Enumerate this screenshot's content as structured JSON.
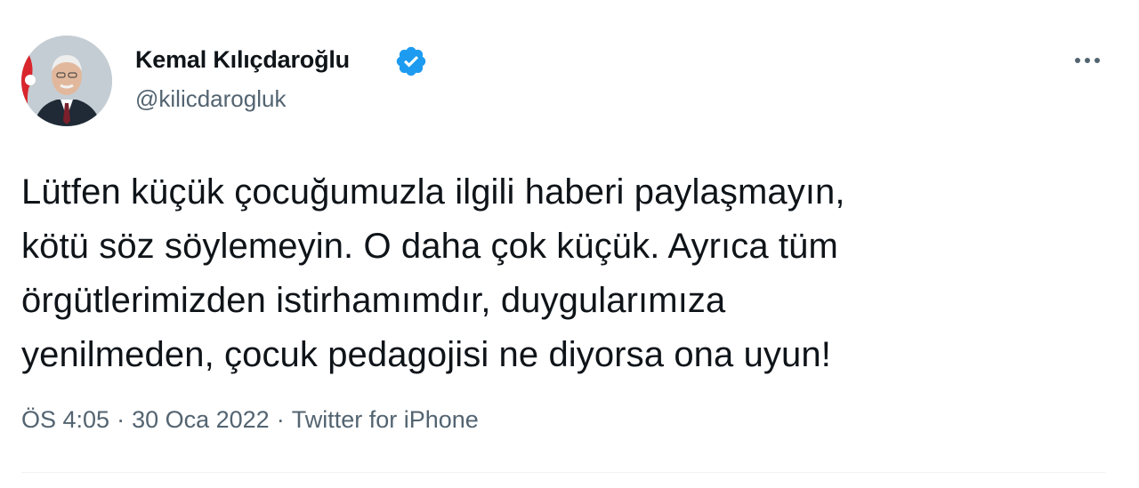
{
  "author": {
    "name": "Kemal Kılıçdaroğlu",
    "handle": "@kilicdarogluk",
    "verified": true
  },
  "more_icon": "more-horizontal-icon",
  "tweet": {
    "text": "Lütfen küçük çocuğumuzla ilgili haberi paylaşmayın,\nkötü söz söylemeyin. O daha çok küçük. Ayrıca tüm\nörgütlerimizden istirhamımdır, duygularımıza\nyenilmeden, çocuk pedagojisi ne diyorsa ona uyun!",
    "time": "ÖS 4:05",
    "date": "30 Oca 2022",
    "source": "Twitter for iPhone",
    "separator": "·"
  },
  "colors": {
    "verified_badge": "#1d9bf0",
    "secondary_text": "#536471",
    "primary_text": "#0f1419"
  }
}
